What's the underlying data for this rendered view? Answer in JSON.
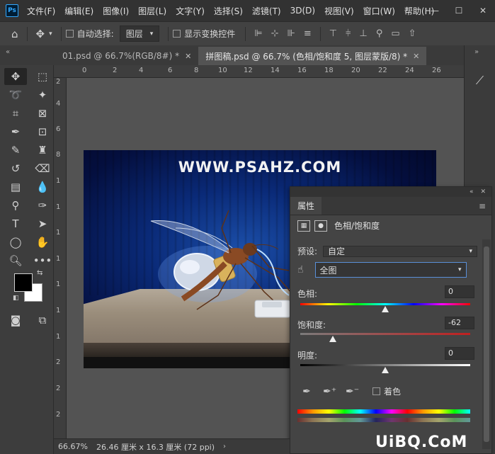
{
  "app": {
    "logo": "Ps"
  },
  "menu": [
    "文件(F)",
    "编辑(E)",
    "图像(I)",
    "图层(L)",
    "文字(Y)",
    "选择(S)",
    "滤镜(T)",
    "3D(D)",
    "视图(V)",
    "窗口(W)",
    "帮助(H)"
  ],
  "window_controls": {
    "minimize": "—",
    "maximize": "☐",
    "close": "✕"
  },
  "options_bar": {
    "auto_select_label": "自动选择:",
    "auto_select_value": "图层",
    "show_transform_label": "显示变换控件"
  },
  "tabs": [
    {
      "label": "01.psd @ 66.7%(RGB/8#) *"
    },
    {
      "label": "拼图稿.psd @ 66.7% (色相/饱和度 5, 图层蒙版/8) *"
    }
  ],
  "ruler_top": [
    "0",
    "2",
    "4",
    "6",
    "8",
    "10",
    "12",
    "14",
    "16",
    "18",
    "20",
    "22",
    "24",
    "26"
  ],
  "ruler_left": [
    "2",
    "4",
    "6",
    "8",
    "1",
    "1",
    "1",
    "1",
    "1",
    "1",
    "1",
    "2",
    "2",
    "2"
  ],
  "artwork": {
    "watermark": "WWW.PSAHZ.COM"
  },
  "properties": {
    "tab": "属性",
    "adjustment_title": "色相/饱和度",
    "preset_label": "预设:",
    "preset_value": "自定",
    "range_value": "全图",
    "hue_label": "色相:",
    "hue_value": "0",
    "saturation_label": "饱和度:",
    "saturation_value": "-62",
    "lightness_label": "明度:",
    "lightness_value": "0",
    "colorize_label": "着色"
  },
  "sliders": {
    "hue_pos": 0.5,
    "saturation_pos": 0.19,
    "lightness_pos": 0.5
  },
  "statusbar": {
    "zoom": "66.67%",
    "doc_size": "26.46 厘米 x 16.3 厘米 (72 ppi)"
  },
  "site_watermark": "UiBQ.CoM",
  "colors": {
    "accent": "#31a8ff",
    "panel": "#444444",
    "canvas_bg": "#535353"
  }
}
